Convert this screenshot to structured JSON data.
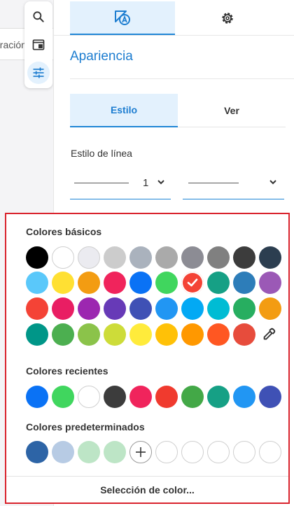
{
  "background": {
    "tab_text": "oración"
  },
  "toolbar": {
    "items": [
      {
        "icon": "search-icon"
      },
      {
        "icon": "window-icon"
      },
      {
        "icon": "sliders-icon",
        "active": true
      }
    ]
  },
  "panel": {
    "top_tabs": [
      {
        "icon": "text-format-icon",
        "active": true
      },
      {
        "icon": "gear-icon",
        "active": false
      }
    ],
    "title": "Apariencia",
    "segments": [
      {
        "label": "Estilo",
        "active": true
      },
      {
        "label": "Ver",
        "active": false
      }
    ],
    "line_style_label": "Estilo de línea",
    "line_width_value": "1"
  },
  "popup": {
    "basic_label": "Colores básicos",
    "recent_label": "Colores recientes",
    "default_label": "Colores predeterminados",
    "picker_label": "Selección de color...",
    "selected_basic_color": "#F44336",
    "basic_colors": [
      [
        "#000000",
        "#FFFFFF",
        "#EBEBF0",
        "#CCCCCC",
        "#AAB2BD",
        "#AAAAAA",
        "#8C8C94",
        "#808080",
        "#3C3C3C",
        "#2C3E50"
      ],
      [
        "#5AC8FA",
        "#FFE033",
        "#F39C12",
        "#F0245C",
        "#0A72F5",
        "#40D65E",
        "#F44336",
        "#16A085",
        "#2D7DB9",
        "#9B59B6"
      ],
      [
        "#F44336",
        "#E91E63",
        "#9C27B0",
        "#673AB7",
        "#3F51B5",
        "#2196F3",
        "#03A9F4",
        "#00BCD4",
        "#27AE60",
        "#F39C12"
      ],
      [
        "#009688",
        "#4CAF50",
        "#8BC34A",
        "#CDDC39",
        "#FFEB3B",
        "#FFC107",
        "#FF9800",
        "#FF5722",
        "#E74C3C"
      ]
    ],
    "recent_colors": [
      "#0A72F5",
      "#40D65E",
      "#FFFFFF",
      "#3C3C3C",
      "#F0245C",
      "#F03A2E",
      "#43A847",
      "#16A085",
      "#2196F3",
      "#3F51B5"
    ],
    "default_colors": [
      "#2D64A6",
      "#B7CBE4",
      "#BDE5C6",
      "#BDE5C6"
    ],
    "default_empty_slots": 5,
    "eyedropper_icon": "eyedropper-icon",
    "add_icon": "plus-icon"
  }
}
